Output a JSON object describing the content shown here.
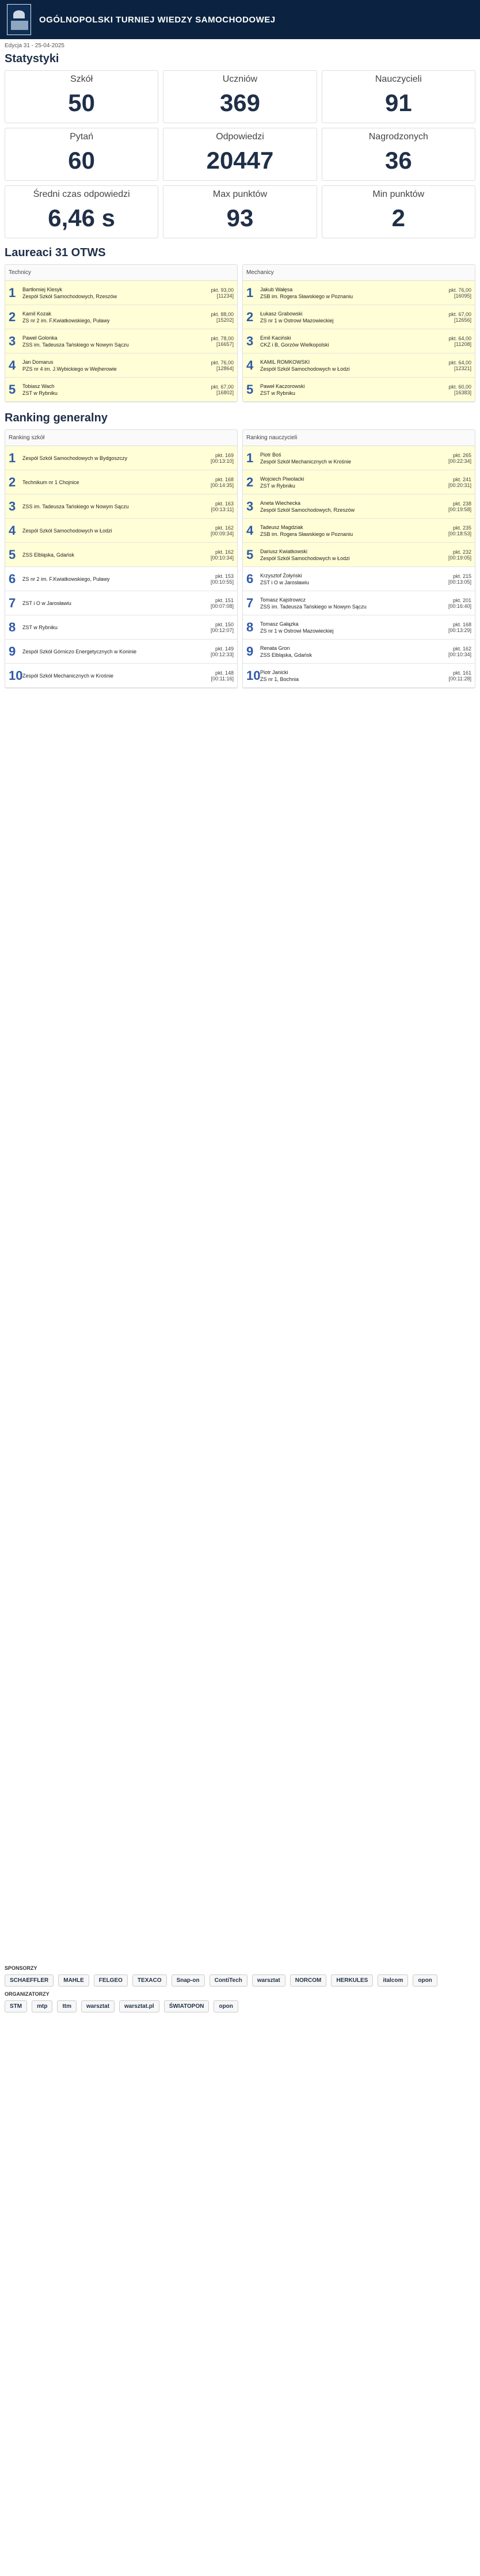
{
  "header": {
    "title": "OGÓLNOPOLSKI TURNIEJ WIEDZY SAMOCHODOWEJ",
    "edition": "Edycja 31 - 25-04-2025"
  },
  "stats_title": "Statystyki",
  "stats": [
    {
      "label": "Szkół",
      "value": "50"
    },
    {
      "label": "Uczniów",
      "value": "369"
    },
    {
      "label": "Nauczycieli",
      "value": "91"
    },
    {
      "label": "Pytań",
      "value": "60"
    },
    {
      "label": "Odpowiedzi",
      "value": "20447"
    },
    {
      "label": "Nagrodzonych",
      "value": "36"
    },
    {
      "label": "Średni czas odpowiedzi",
      "value": "6,46 s"
    },
    {
      "label": "Max punktów",
      "value": "93"
    },
    {
      "label": "Min punktów",
      "value": "2"
    }
  ],
  "laureates": {
    "title": "Laureaci 31 OTWS",
    "left": {
      "head": "Technicy",
      "items": [
        [
          "Bartłomiej Klesyk",
          "Zespół Szkół Samochodowych, Rzeszów",
          "pkt. 93,00\n[11234]"
        ],
        [
          "Kamil Kozak",
          "ZS nr 2 im. F.Kwiatkowskiego, Puławy",
          "pkt. 88,00\n[15202]"
        ],
        [
          "Paweł Golonka",
          "ZSS im. Tadeusza Tańskiego w Nowym Sączu",
          "pkt. 78,00\n[16657]"
        ],
        [
          "Jan Domarus",
          "PZS nr 4 im. J.Wybickiego w Wejherowie",
          "pkt. 76,00\n[12864]"
        ],
        [
          "Tobiasz Wach",
          "ZST w Rybniku",
          "pkt. 67,00\n[16802]"
        ]
      ]
    },
    "right": {
      "head": "Mechanicy",
      "items": [
        [
          "Jakub Wałęsa",
          "ZSB im. Rogera Sławskiego w Poznaniu",
          "pkt. 76,00\n[16095]"
        ],
        [
          "Łukasz Grabowski",
          "ZS nr 1 w Ostrowi Mazowieckiej",
          "pkt. 67,00\n[12656]"
        ],
        [
          "Emil Kaciński",
          "CKZ i B, Gorzów Wielkopolski",
          "pkt. 64,00\n[11208]"
        ],
        [
          "KAMIL ROMKOWSKI",
          "Zespół Szkół Samochodowych w Łodzi",
          "pkt. 64,00\n[12321]"
        ],
        [
          "Paweł Kaczorowski",
          "ZST w Rybniku",
          "pkt. 60,00\n[16383]"
        ]
      ]
    }
  },
  "ranking": {
    "title": "Ranking generalny",
    "schools": {
      "head": "Ranking szkół",
      "items": [
        [
          "Zespół Szkół Samochodowych w Bydgoszczy",
          "pkt. 169\n[00:13:10]"
        ],
        [
          "Technikum nr 1 Chojnice",
          "pkt. 168\n[00:14:35]"
        ],
        [
          "ZSS im. Tadeusza Tańskiego w Nowym Sączu",
          "pkt. 163\n[00:13:11]"
        ],
        [
          "Zespół Szkół Samochodowych w Łodzi",
          "pkt. 162\n[00:09:34]"
        ],
        [
          "ZSS Elbląska, Gdańsk",
          "pkt. 162\n[00:10:34]"
        ],
        [
          "ZS nr 2 im. F.Kwiatkowskiego, Puławy",
          "pkt. 153\n[00:10:55]"
        ],
        [
          "ZST i O w Jarosławiu",
          "pkt. 151\n[00:07:08]"
        ],
        [
          "ZST w Rybniku",
          "pkt. 150\n[00:12:07]"
        ],
        [
          "Zespół Szkół Górniczo Energetycznych w Koninie",
          "pkt. 149\n[00:12:33]"
        ],
        [
          "Zespół Szkół Mechanicznych w Krośnie",
          "pkt. 148\n[00:11:16]"
        ]
      ]
    },
    "teachers": {
      "head": "Ranking nauczycieli",
      "items": [
        [
          "Piotr Boś",
          "Zespół Szkół Mechanicznych w Krośnie",
          "pkt. 265\n[00:22:34]"
        ],
        [
          "Wojciech Piwolacki",
          "ZST w Rybniku",
          "pkt. 241\n[00:20:31]"
        ],
        [
          "Aneta Wiechecka",
          "Zespół Szkół Samochodowych, Rzeszów",
          "pkt. 238\n[00:19:58]"
        ],
        [
          "Tadeusz Magdziak",
          "ZSB im. Rogera Sławskiego w Poznaniu",
          "pkt. 235\n[00:18:53]"
        ],
        [
          "Dariusz Kwiatkowski",
          "Zespół Szkół Samochodowych w Łodzi",
          "pkt. 232\n[00:19:05]"
        ],
        [
          "Krzysztof Żołyński",
          "ZST i O w Jarosławiu",
          "pkt. 215\n[00:13:05]"
        ],
        [
          "Tomasz Kajstrowicz",
          "ZSS im. Tadeusza Tańskiego w Nowym Sączu",
          "pkt. 201\n[00:16:40]"
        ],
        [
          "Tomasz Gałązka",
          "ZS nr 1 w Ostrowi Mazowieckiej",
          "pkt. 168\n[00:13:29]"
        ],
        [
          "Renata Gron",
          "ZSS Elbląska, Gdańsk",
          "pkt. 162\n[00:10:34]"
        ],
        [
          "Piotr Janicki",
          "ZS nr 1, Bochnia",
          "pkt. 161\n[00:11:28]"
        ]
      ]
    }
  },
  "sponsors": {
    "label": "SPONSORZY",
    "logos": [
      "SCHAEFFLER",
      "MAHLE",
      "FELGEO",
      "TEXACO",
      "Snap-on",
      "ContiTech",
      "warsztat",
      "NORCOM",
      "HERKULES",
      "italcom",
      "opon"
    ],
    "org_label": "ORGANIZATORZY",
    "org": [
      "STM",
      "mtp",
      "ttm",
      "warsztat",
      "warsztat.pl",
      "ŚWIATOPON",
      "opon"
    ]
  }
}
